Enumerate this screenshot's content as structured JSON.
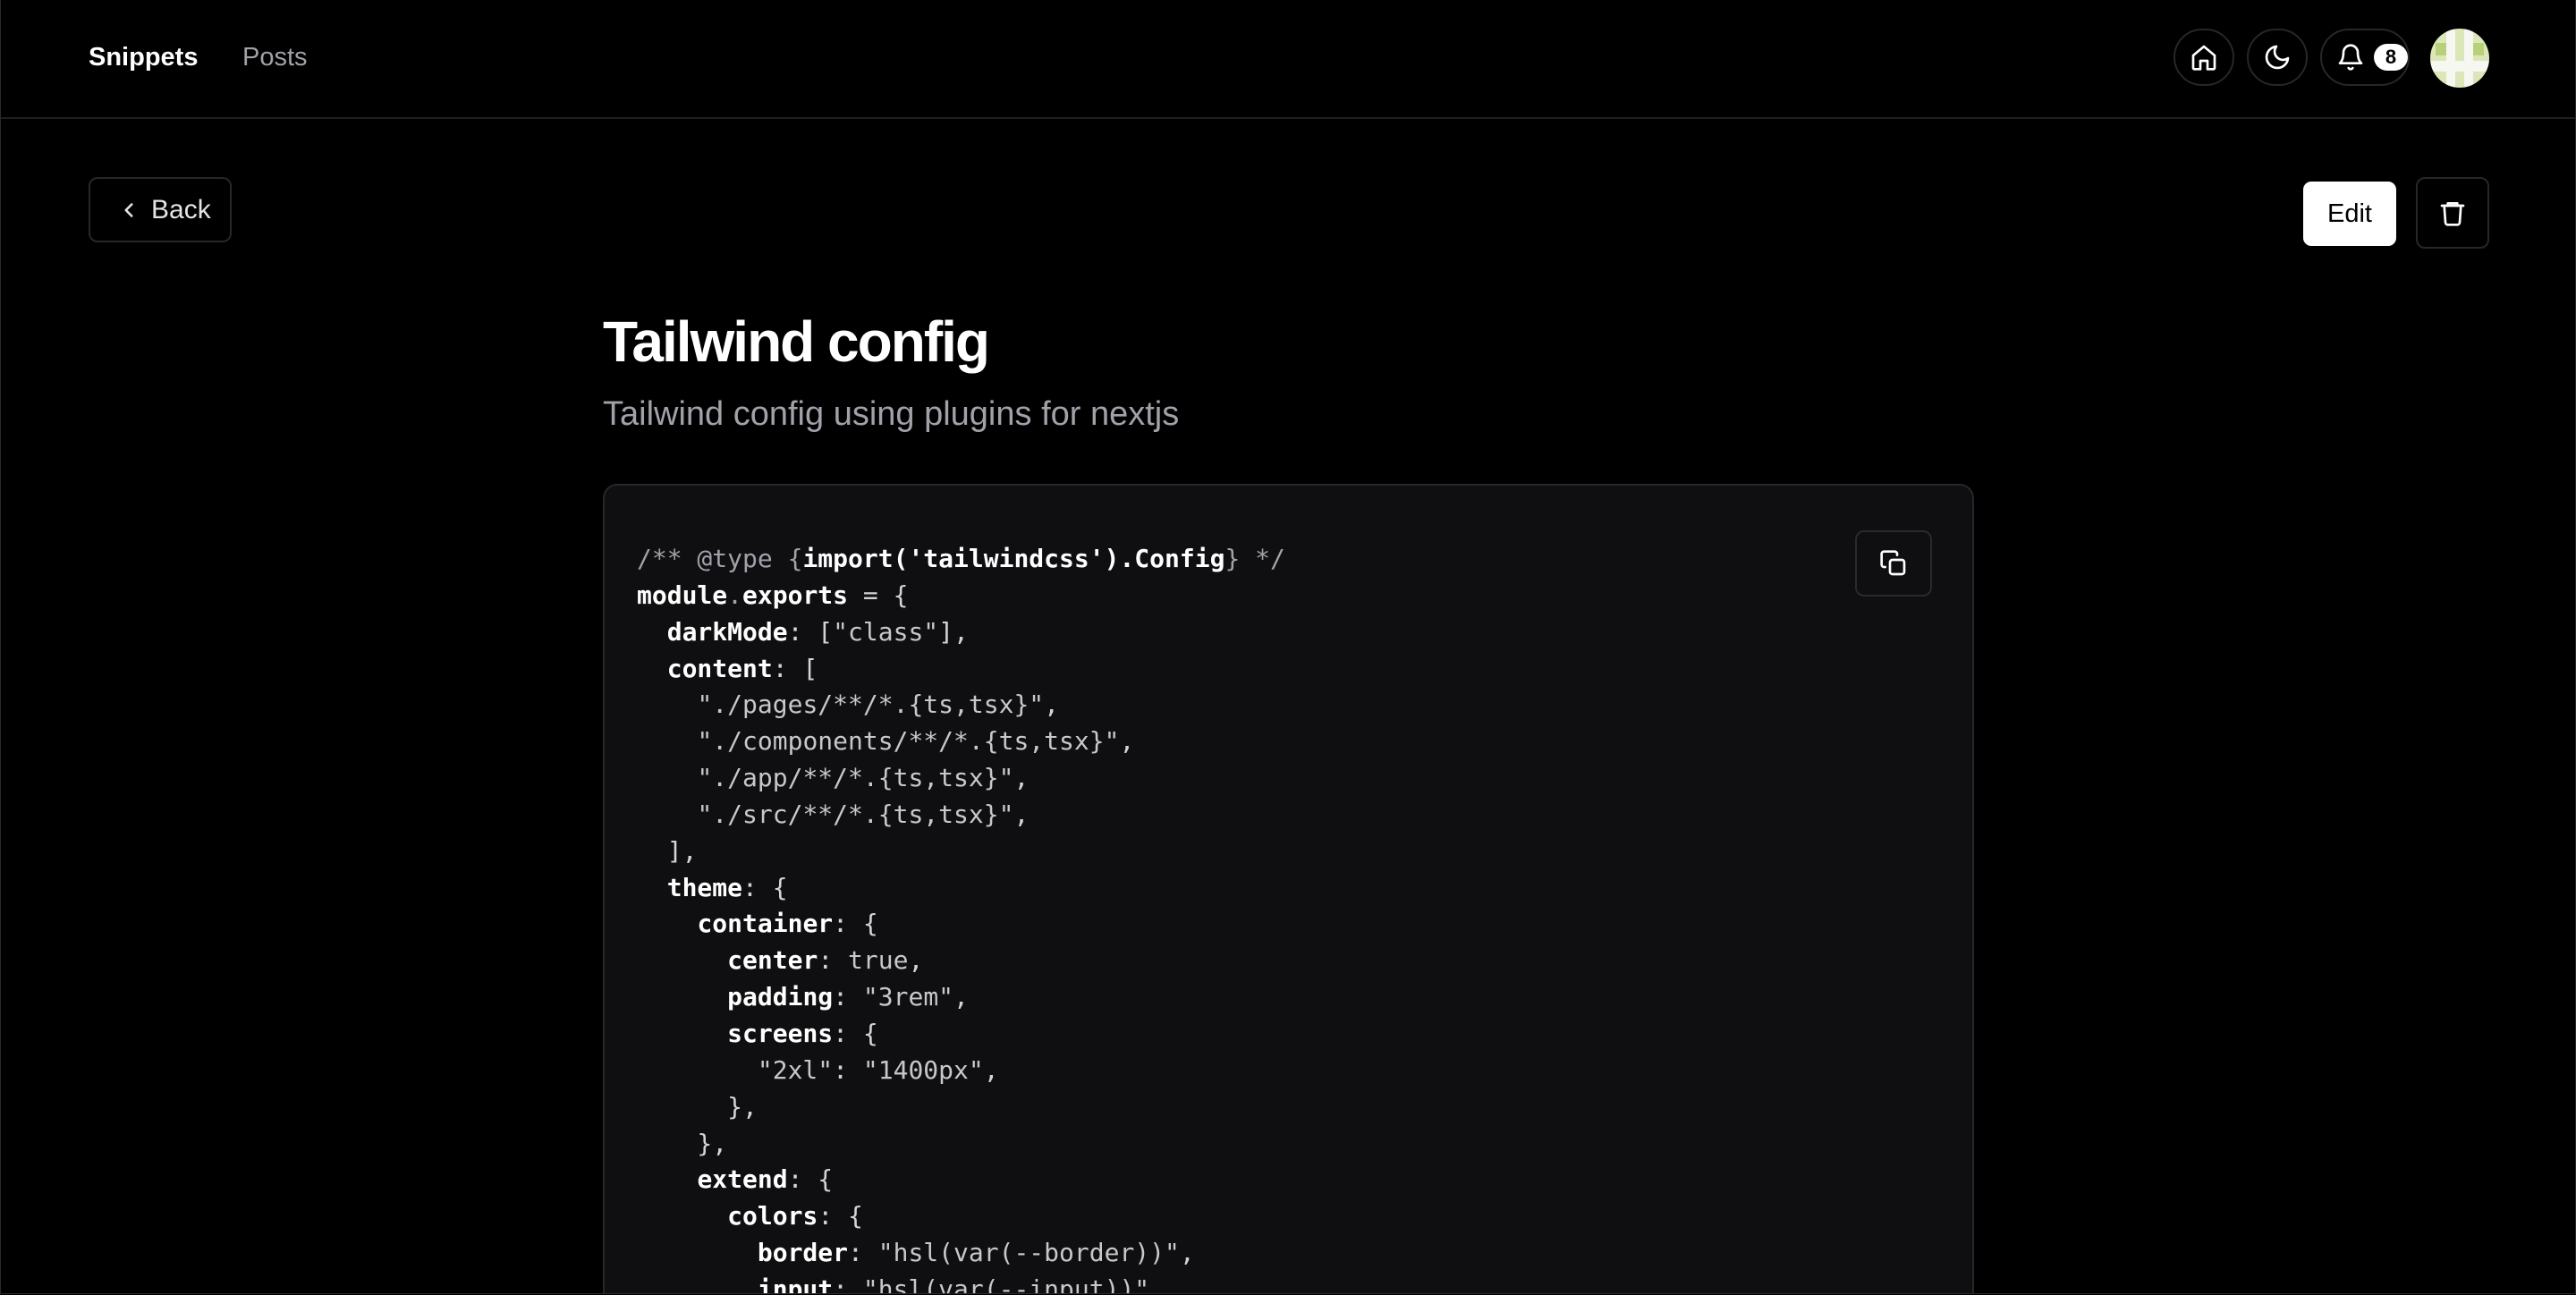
{
  "header": {
    "nav": [
      {
        "label": "Snippets",
        "active": true
      },
      {
        "label": "Posts",
        "active": false
      }
    ],
    "notification_count": "8",
    "icons": {
      "home": "home-icon",
      "theme": "moon-icon",
      "notifications": "bell-icon"
    }
  },
  "actions": {
    "back_label": "Back",
    "edit_label": "Edit",
    "delete_icon": "trash-icon"
  },
  "snippet": {
    "title": "Tailwind config",
    "description": "Tailwind config using plugins for nextjs",
    "copy_icon": "copy-icon",
    "code_lines": [
      "/** @type {import('tailwindcss').Config} */",
      "module.exports = {",
      "  darkMode: [\"class\"],",
      "  content: [",
      "    \"./pages/**/*.{ts,tsx}\",",
      "    \"./components/**/*.{ts,tsx}\",",
      "    \"./app/**/*.{ts,tsx}\",",
      "    \"./src/**/*.{ts,tsx}\",",
      "  ],",
      "  theme: {",
      "    container: {",
      "      center: true,",
      "      padding: \"3rem\",",
      "      screens: {",
      "        \"2xl\": \"1400px\",",
      "      },",
      "    },",
      "    extend: {",
      "      colors: {",
      "        border: \"hsl(var(--border))\",",
      "        input: \"hsl(var(--input))\","
    ]
  },
  "colors": {
    "background": "#000000",
    "text": "#ffffff",
    "muted": "#a1a1aa",
    "card": "#0f0f11",
    "border": "#27272a"
  }
}
